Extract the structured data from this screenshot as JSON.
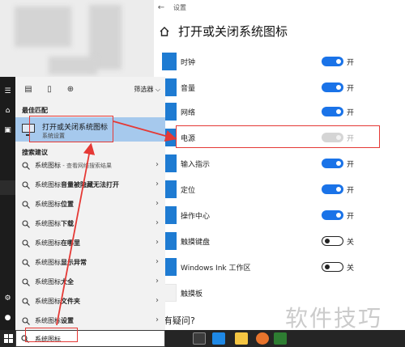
{
  "settings": {
    "app_name": "设置",
    "title": "打开或关闭系统图标",
    "rows": [
      {
        "label": "时钟",
        "state": "开",
        "on": true,
        "icon": "clock-icon"
      },
      {
        "label": "音量",
        "state": "开",
        "on": true,
        "icon": "speaker-icon"
      },
      {
        "label": "网络",
        "state": "开",
        "on": true,
        "icon": "globe-icon"
      },
      {
        "label": "电源",
        "state": "开",
        "on": true,
        "disabled": true,
        "icon": "battery-icon"
      },
      {
        "label": "输入指示",
        "state": "开",
        "on": true,
        "icon": "keyboard-icon"
      },
      {
        "label": "定位",
        "state": "开",
        "on": true,
        "icon": "location-icon"
      },
      {
        "label": "操作中心",
        "state": "开",
        "on": true,
        "icon": "action-center-icon"
      },
      {
        "label": "触摸键盘",
        "state": "关",
        "on": false,
        "icon": "touch-keyboard-icon"
      },
      {
        "label": "Windows Ink 工作区",
        "state": "关",
        "on": false,
        "icon": "ink-icon"
      },
      {
        "label": "触摸板",
        "state": "",
        "on": null,
        "icon": "touchpad-icon"
      }
    ],
    "bottom_text": "有疑问?"
  },
  "search_panel": {
    "filter_label": "筛选器",
    "best_match_heading": "最佳匹配",
    "best_match": {
      "title": "打开或关闭系统图标",
      "subtitle": "系统设置"
    },
    "suggestions_heading": "搜索建议",
    "suggestions": [
      {
        "prefix": "系统图标",
        "bold": "",
        "suffix": " - 查看网络搜索结果"
      },
      {
        "prefix": "系统图标",
        "bold": "音量被隐藏无法打开",
        "suffix": ""
      },
      {
        "prefix": "系统图标",
        "bold": "位置",
        "suffix": ""
      },
      {
        "prefix": "系统图标",
        "bold": "下载",
        "suffix": ""
      },
      {
        "prefix": "系统图标",
        "bold": "在哪里",
        "suffix": ""
      },
      {
        "prefix": "系统图标",
        "bold": "显示异常",
        "suffix": ""
      },
      {
        "prefix": "系统图标",
        "bold": "大全",
        "suffix": ""
      },
      {
        "prefix": "系统图标",
        "bold": "文件夹",
        "suffix": ""
      },
      {
        "prefix": "系统图标",
        "bold": "设置",
        "suffix": ""
      }
    ]
  },
  "taskbar": {
    "search_text": "系统图标"
  },
  "watermark": "软件技巧",
  "colors": {
    "accent": "#1a73e8",
    "highlight": "#a6c9ed",
    "annotation": "#e53935"
  }
}
